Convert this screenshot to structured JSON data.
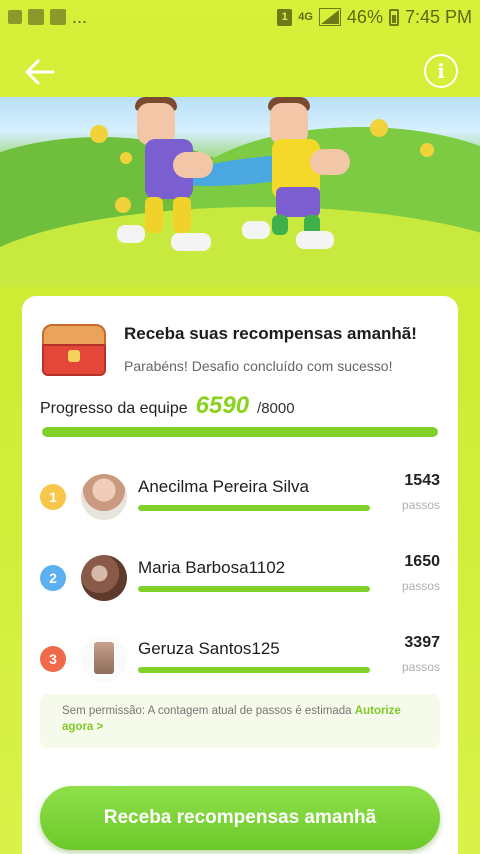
{
  "status_bar": {
    "left_icons": [
      "usb-icon",
      "photo-icon",
      "notification-icon"
    ],
    "ellipsis": "...",
    "sim_badge": "1",
    "network": "4G",
    "battery": "46%",
    "time": "7:45 PM"
  },
  "header": {
    "back_icon": "back-arrow-icon",
    "info_icon": "info-icon",
    "info_glyph": "i"
  },
  "reward": {
    "title": "Receba suas recompensas amanhã!",
    "subtitle": "Parabéns! Desafio concluído com sucesso!"
  },
  "team_progress": {
    "label": "Progresso da equipe",
    "value": "6590",
    "total": "/8000",
    "fill_fraction": 1.0
  },
  "members": [
    {
      "rank": "1",
      "name": "Anecilma Pereira Silva",
      "steps": "1543",
      "unit": "passos"
    },
    {
      "rank": "2",
      "name": "Maria Barbosa1102",
      "steps": "1650",
      "unit": "passos"
    },
    {
      "rank": "3",
      "name": "Geruza Santos125",
      "steps": "3397",
      "unit": "passos"
    }
  ],
  "notice": {
    "text": "Sem permissão: A contagem atual de passos é estimada",
    "link": "Autorize agora >"
  },
  "cta": {
    "label": "Receba recompensas amanhã"
  }
}
